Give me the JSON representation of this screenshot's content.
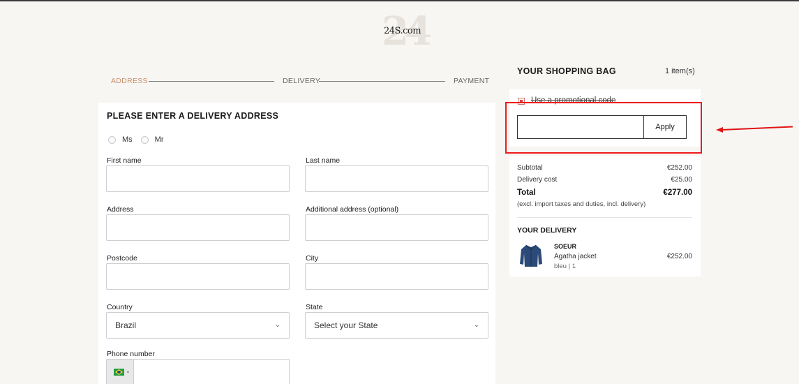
{
  "header": {
    "logo_text": "24S.com"
  },
  "steps": {
    "address": "ADDRESS",
    "delivery": "DELIVERY",
    "payment": "PAYMENT"
  },
  "form": {
    "title": "PLEASE ENTER A DELIVERY ADDRESS",
    "salutations": [
      "Ms",
      "Mr"
    ],
    "first_name_label": "First name",
    "last_name_label": "Last name",
    "address_label": "Address",
    "additional_address_label": "Additional address (optional)",
    "postcode_label": "Postcode",
    "city_label": "City",
    "country_label": "Country",
    "country_value": "Brazil",
    "state_label": "State",
    "state_value": "Select your State",
    "phone_label": "Phone number"
  },
  "bag": {
    "title": "YOUR SHOPPING BAG",
    "count": "1 item(s)",
    "promo_label": "Use a promotional code",
    "promo_value": "",
    "apply_label": "Apply",
    "subtotal_label": "Subtotal",
    "subtotal_value": "€252.00",
    "delivery_label": "Delivery cost",
    "delivery_value": "€25.00",
    "total_label": "Total",
    "total_value": "€277.00",
    "total_note": "(excl. import taxes and duties, incl. delivery)",
    "delivery_title": "YOUR DELIVERY",
    "item": {
      "brand": "SOEUR",
      "name": "Agatha jacket",
      "meta": "bleu  |  1",
      "price": "€252.00"
    }
  },
  "colors": {
    "accent_step": "#c8906a",
    "annotation_red": "#ef1a1a",
    "background": "#f7f6f3"
  },
  "icons": {
    "dropdown": "chevron-down-icon",
    "phone_flag": "brazil-flag-icon"
  }
}
